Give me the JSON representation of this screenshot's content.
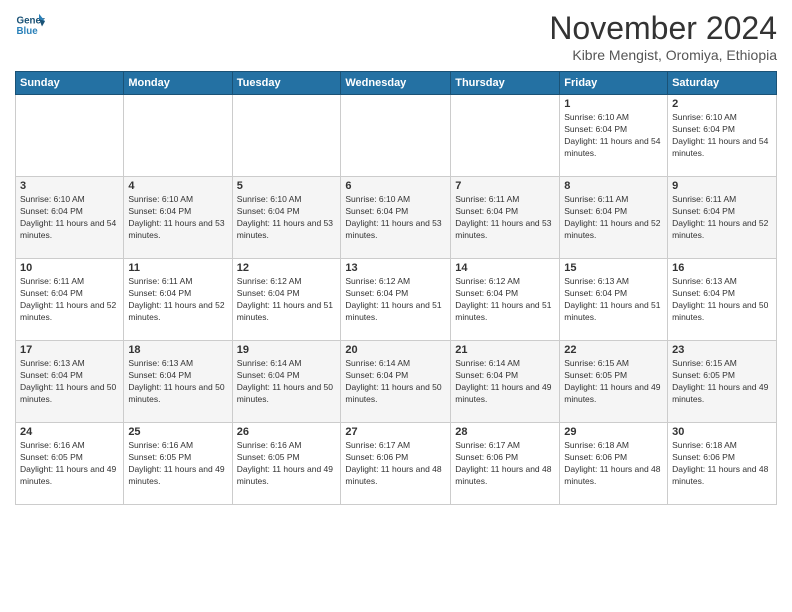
{
  "header": {
    "logo_line1": "General",
    "logo_line2": "Blue",
    "month_title": "November 2024",
    "location": "Kibre Mengist, Oromiya, Ethiopia"
  },
  "weekdays": [
    "Sunday",
    "Monday",
    "Tuesday",
    "Wednesday",
    "Thursday",
    "Friday",
    "Saturday"
  ],
  "weeks": [
    [
      {
        "day": "",
        "info": ""
      },
      {
        "day": "",
        "info": ""
      },
      {
        "day": "",
        "info": ""
      },
      {
        "day": "",
        "info": ""
      },
      {
        "day": "",
        "info": ""
      },
      {
        "day": "1",
        "info": "Sunrise: 6:10 AM\nSunset: 6:04 PM\nDaylight: 11 hours and 54 minutes."
      },
      {
        "day": "2",
        "info": "Sunrise: 6:10 AM\nSunset: 6:04 PM\nDaylight: 11 hours and 54 minutes."
      }
    ],
    [
      {
        "day": "3",
        "info": "Sunrise: 6:10 AM\nSunset: 6:04 PM\nDaylight: 11 hours and 54 minutes."
      },
      {
        "day": "4",
        "info": "Sunrise: 6:10 AM\nSunset: 6:04 PM\nDaylight: 11 hours and 53 minutes."
      },
      {
        "day": "5",
        "info": "Sunrise: 6:10 AM\nSunset: 6:04 PM\nDaylight: 11 hours and 53 minutes."
      },
      {
        "day": "6",
        "info": "Sunrise: 6:10 AM\nSunset: 6:04 PM\nDaylight: 11 hours and 53 minutes."
      },
      {
        "day": "7",
        "info": "Sunrise: 6:11 AM\nSunset: 6:04 PM\nDaylight: 11 hours and 53 minutes."
      },
      {
        "day": "8",
        "info": "Sunrise: 6:11 AM\nSunset: 6:04 PM\nDaylight: 11 hours and 52 minutes."
      },
      {
        "day": "9",
        "info": "Sunrise: 6:11 AM\nSunset: 6:04 PM\nDaylight: 11 hours and 52 minutes."
      }
    ],
    [
      {
        "day": "10",
        "info": "Sunrise: 6:11 AM\nSunset: 6:04 PM\nDaylight: 11 hours and 52 minutes."
      },
      {
        "day": "11",
        "info": "Sunrise: 6:11 AM\nSunset: 6:04 PM\nDaylight: 11 hours and 52 minutes."
      },
      {
        "day": "12",
        "info": "Sunrise: 6:12 AM\nSunset: 6:04 PM\nDaylight: 11 hours and 51 minutes."
      },
      {
        "day": "13",
        "info": "Sunrise: 6:12 AM\nSunset: 6:04 PM\nDaylight: 11 hours and 51 minutes."
      },
      {
        "day": "14",
        "info": "Sunrise: 6:12 AM\nSunset: 6:04 PM\nDaylight: 11 hours and 51 minutes."
      },
      {
        "day": "15",
        "info": "Sunrise: 6:13 AM\nSunset: 6:04 PM\nDaylight: 11 hours and 51 minutes."
      },
      {
        "day": "16",
        "info": "Sunrise: 6:13 AM\nSunset: 6:04 PM\nDaylight: 11 hours and 50 minutes."
      }
    ],
    [
      {
        "day": "17",
        "info": "Sunrise: 6:13 AM\nSunset: 6:04 PM\nDaylight: 11 hours and 50 minutes."
      },
      {
        "day": "18",
        "info": "Sunrise: 6:13 AM\nSunset: 6:04 PM\nDaylight: 11 hours and 50 minutes."
      },
      {
        "day": "19",
        "info": "Sunrise: 6:14 AM\nSunset: 6:04 PM\nDaylight: 11 hours and 50 minutes."
      },
      {
        "day": "20",
        "info": "Sunrise: 6:14 AM\nSunset: 6:04 PM\nDaylight: 11 hours and 50 minutes."
      },
      {
        "day": "21",
        "info": "Sunrise: 6:14 AM\nSunset: 6:04 PM\nDaylight: 11 hours and 49 minutes."
      },
      {
        "day": "22",
        "info": "Sunrise: 6:15 AM\nSunset: 6:05 PM\nDaylight: 11 hours and 49 minutes."
      },
      {
        "day": "23",
        "info": "Sunrise: 6:15 AM\nSunset: 6:05 PM\nDaylight: 11 hours and 49 minutes."
      }
    ],
    [
      {
        "day": "24",
        "info": "Sunrise: 6:16 AM\nSunset: 6:05 PM\nDaylight: 11 hours and 49 minutes."
      },
      {
        "day": "25",
        "info": "Sunrise: 6:16 AM\nSunset: 6:05 PM\nDaylight: 11 hours and 49 minutes."
      },
      {
        "day": "26",
        "info": "Sunrise: 6:16 AM\nSunset: 6:05 PM\nDaylight: 11 hours and 49 minutes."
      },
      {
        "day": "27",
        "info": "Sunrise: 6:17 AM\nSunset: 6:06 PM\nDaylight: 11 hours and 48 minutes."
      },
      {
        "day": "28",
        "info": "Sunrise: 6:17 AM\nSunset: 6:06 PM\nDaylight: 11 hours and 48 minutes."
      },
      {
        "day": "29",
        "info": "Sunrise: 6:18 AM\nSunset: 6:06 PM\nDaylight: 11 hours and 48 minutes."
      },
      {
        "day": "30",
        "info": "Sunrise: 6:18 AM\nSunset: 6:06 PM\nDaylight: 11 hours and 48 minutes."
      }
    ]
  ]
}
